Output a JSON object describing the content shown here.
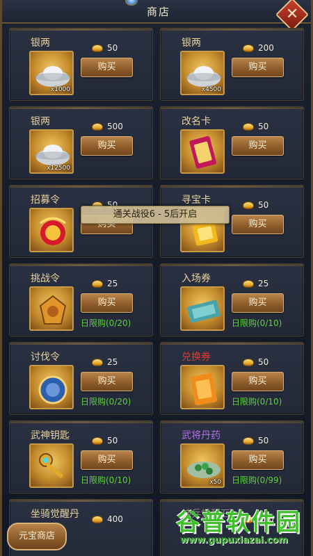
{
  "header": {
    "title": "商店"
  },
  "colors": {
    "accent": "#c79b48",
    "limit_text": "#5fd23c",
    "gold": "#e0a223"
  },
  "items": [
    {
      "name": "银两",
      "price": "50",
      "buy": "购买",
      "qty": "x1000",
      "limit": "",
      "icon": "silver-ingot-icon"
    },
    {
      "name": "银两",
      "price": "200",
      "buy": "购买",
      "qty": "x4500",
      "limit": "",
      "icon": "silver-ingot-icon"
    },
    {
      "name": "银两",
      "price": "500",
      "buy": "购买",
      "qty": "x12500",
      "limit": "",
      "icon": "silver-ingot-icon"
    },
    {
      "name": "改名卡",
      "price": "50",
      "buy": "购买",
      "qty": "",
      "limit": "",
      "icon": "rename-card-icon"
    },
    {
      "name": "招募令",
      "price": "50",
      "buy": "购买",
      "qty": "",
      "limit": "",
      "icon": "recruit-token-icon"
    },
    {
      "name": "寻宝卡",
      "price": "50",
      "buy": "购买",
      "qty": "",
      "limit": "",
      "icon": "treasure-card-icon"
    },
    {
      "name": "挑战令",
      "price": "25",
      "buy": "购买",
      "qty": "",
      "limit": "日限购(0/20)",
      "icon": "challenge-token-icon"
    },
    {
      "name": "入场券",
      "price": "25",
      "buy": "购买",
      "qty": "",
      "limit": "日限购(0/10)",
      "icon": "ticket-icon"
    },
    {
      "name": "讨伐令",
      "price": "25",
      "buy": "购买",
      "qty": "",
      "limit": "日限购(0/20)",
      "icon": "crusade-token-icon"
    },
    {
      "name": "兑换券",
      "price": "50",
      "buy": "购买",
      "qty": "",
      "limit": "日限购(0/10)",
      "icon": "exchange-coupon-icon"
    },
    {
      "name": "武神钥匙",
      "price": "50",
      "buy": "购买",
      "qty": "",
      "limit": "日限购(0/10)",
      "icon": "key-icon"
    },
    {
      "name": "武将丹药",
      "price": "50",
      "buy": "购买",
      "qty": "x50",
      "limit": "日限购(0/99)",
      "icon": "pill-icon"
    },
    {
      "name": "坐骑觉醒丹",
      "price": "400",
      "buy": "",
      "qty": "",
      "limit": "",
      "icon": "mount-pill-icon"
    },
    {
      "name": "神兵觉醒石",
      "price": "400",
      "buy": "",
      "qty": "",
      "limit": "",
      "icon": "weapon-stone-icon"
    }
  ],
  "tooltip": "通关战役6 - 5后开启",
  "footer": {
    "yuanbao_shop": "元宝商店"
  },
  "watermark": {
    "main": "谷普软件园",
    "url": "www.gupuxiazai.com"
  }
}
